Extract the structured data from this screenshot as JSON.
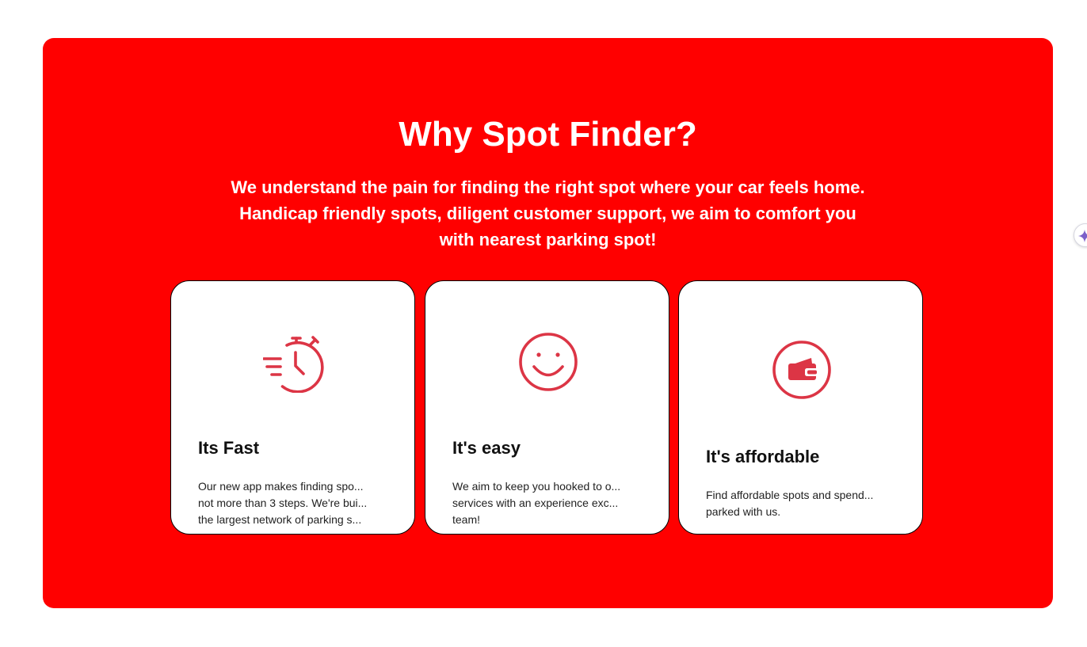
{
  "section": {
    "title": "Why Spot Finder?",
    "subtitle_lines": [
      "We understand the pain for finding the right spot where your car feels home.",
      "Handicap friendly spots, diligent customer support, we aim to comfort you",
      "with nearest parking spot!"
    ]
  },
  "colors": {
    "panel_background": "#ff0000",
    "icon_color": "#dc3545",
    "card_background": "#ffffff"
  },
  "cards": [
    {
      "icon": "stopwatch-icon",
      "title": "Its Fast",
      "text_lines": [
        "Our new app makes finding spo...",
        "not more than 3 steps. We're bui...",
        "the largest network of parking s..."
      ]
    },
    {
      "icon": "smiley-face-icon",
      "title": "It's easy",
      "text_lines": [
        "We aim to keep you hooked to o...",
        "services with an experience exc...",
        "team!"
      ]
    },
    {
      "icon": "wallet-icon",
      "title": "It's affordable",
      "text_lines": [
        "Find affordable spots and spend...",
        "parked with us."
      ]
    }
  ],
  "side_widget": {
    "icon": "sparkle-icon"
  }
}
